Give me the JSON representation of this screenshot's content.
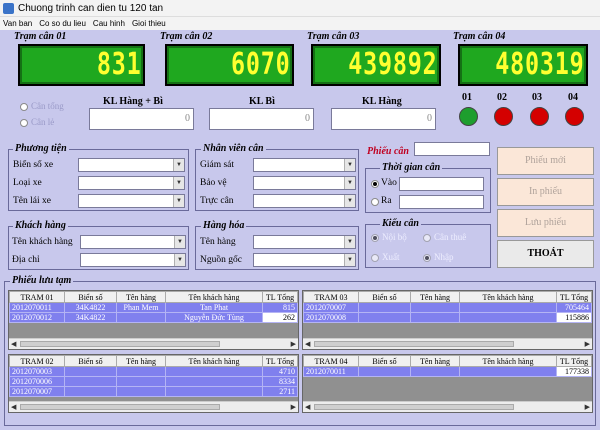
{
  "window": {
    "title": "Chuong trinh can dien tu 120 tan"
  },
  "menu": [
    "Van ban",
    "Co so du lieu",
    "Cau hinh",
    "Gioi thieu"
  ],
  "scales": [
    {
      "label": "Trạm cân 01",
      "value": "831"
    },
    {
      "label": "Trạm cân 02",
      "value": "6070"
    },
    {
      "label": "Trạm cân 03",
      "value": "439892"
    },
    {
      "label": "Trạm cân 04",
      "value": "480319"
    }
  ],
  "mode": {
    "opt1": "Cân tổng",
    "opt2": "Cân lẻ"
  },
  "weights": {
    "h1": "KL Hàng + Bì",
    "h2": "KL Bì",
    "h3": "KL Hàng",
    "v1": "0",
    "v2": "0",
    "v3": "0"
  },
  "lights": [
    {
      "label": "01",
      "color": "#1e9e2e"
    },
    {
      "label": "02",
      "color": "#d40000"
    },
    {
      "label": "03",
      "color": "#d40000"
    },
    {
      "label": "04",
      "color": "#d40000"
    }
  ],
  "vehicle": {
    "title": "Phương tiện",
    "plate": "Biển số xe",
    "type": "Loại xe",
    "driver": "Tên lái xe"
  },
  "staff": {
    "title": "Nhân viên cân",
    "supervisor": "Giám sát",
    "guard": "Bảo vệ",
    "operator": "Trực cân"
  },
  "customer": {
    "title": "Khách hàng",
    "name": "Tên khách hàng",
    "address": "Địa chỉ"
  },
  "goods": {
    "title": "Hàng hóa",
    "name": "Tên hàng",
    "origin": "Nguồn gốc"
  },
  "ticket": {
    "label": "Phiếu cân"
  },
  "time": {
    "title": "Thời gian cân",
    "in": "Vào",
    "out": "Ra"
  },
  "kind": {
    "title": "Kiểu cân",
    "opt1": "Nội bộ",
    "opt2": "Cân thuê",
    "opt3": "Xuất",
    "opt4": "Nhập"
  },
  "buttons": {
    "new": "Phiếu mới",
    "print": "In phiếu",
    "save": "Lưu phiếu",
    "exit": "THOÁT"
  },
  "temp": {
    "title": "Phiếu lưu tạm"
  },
  "grids": [
    {
      "cols": [
        "TRAM 01",
        "Biển số",
        "Tên hàng",
        "Tên khách hàng",
        "TL Tổng"
      ],
      "rows": [
        [
          "2012070011",
          "34K4822",
          "Phan Mem",
          "Tan Phat",
          "815"
        ],
        [
          "2012070012",
          "34K4822",
          "",
          "Nguyễn Đức Tùng",
          "262"
        ]
      ]
    },
    {
      "cols": [
        "TRAM 03",
        "Biển số",
        "Tên hàng",
        "Tên khách hàng",
        "TL Tổng"
      ],
      "rows": [
        [
          "2012070007",
          "",
          "",
          "",
          "705464"
        ],
        [
          "2012070008",
          "",
          "",
          "",
          "115886"
        ]
      ]
    },
    {
      "cols": [
        "TRAM 02",
        "Biển số",
        "Tên hàng",
        "Tên khách hàng",
        "TL Tổng"
      ],
      "rows": [
        [
          "2012070003",
          "",
          "",
          "",
          "4710"
        ],
        [
          "2012070006",
          "",
          "",
          "",
          "8334"
        ],
        [
          "2012070007",
          "",
          "",
          "",
          "2711"
        ]
      ]
    },
    {
      "cols": [
        "TRAM 04",
        "Biển số",
        "Tên hàng",
        "Tên khách hàng",
        "TL Tổng"
      ],
      "rows": [
        [
          "2012070011",
          "",
          "",
          "",
          "177338"
        ]
      ]
    }
  ]
}
